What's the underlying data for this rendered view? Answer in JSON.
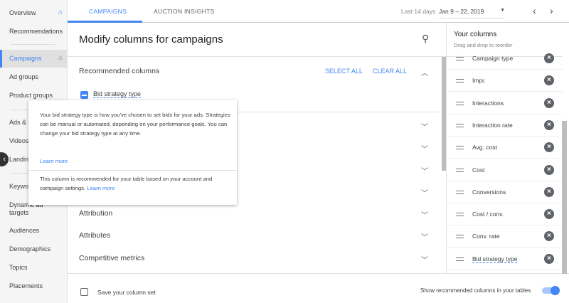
{
  "sidebar": {
    "items": [
      "Overview",
      "Recommendations",
      "Campaigns",
      "Ad groups",
      "Product groups",
      "Ads & e",
      "Videos",
      "Landing",
      "Keywo",
      "Dynamic ad targets",
      "Audiences",
      "Demographics",
      "Topics",
      "Placements"
    ],
    "active": "Campaigns"
  },
  "tabs": [
    "CAMPAIGNS",
    "AUCTION INSIGHTS"
  ],
  "date": {
    "label": "Last 14 days",
    "range": "Jan 9 – 22, 2019"
  },
  "dialog": {
    "title": "Modify columns for campaigns",
    "recommended": {
      "title": "Recommended columns",
      "select_all": "SELECT ALL",
      "clear_all": "CLEAR ALL",
      "item": "Bid strategy type"
    },
    "sections": [
      "Attribution",
      "Attributes",
      "Competitive metrics"
    ],
    "save_label": "Save your column set",
    "show_recommended": "Show recommended columns in your tables",
    "show_recommended_on": true
  },
  "tooltip": {
    "text": "Your bid strategy type is how you've chosen to set bids for your ads. Strategies can be manual or automated, depending on your performance goals. You can change your bid strategy type at any time.",
    "learn_more": "Learn more",
    "note": "This column is recommended for your table based on your account and campaign settings.",
    "note_link": "Learn more"
  },
  "your_columns": {
    "title": "Your columns",
    "subtitle": "Drag and drop to reorder",
    "items": [
      "Campaign type",
      "Impr.",
      "Interactions",
      "Interaction rate",
      "Avg. cost",
      "Cost",
      "Conversions",
      "Cost / conv.",
      "Conv. rate",
      "Bid strategy type"
    ]
  },
  "colors": {
    "accent": "#4285f4"
  }
}
